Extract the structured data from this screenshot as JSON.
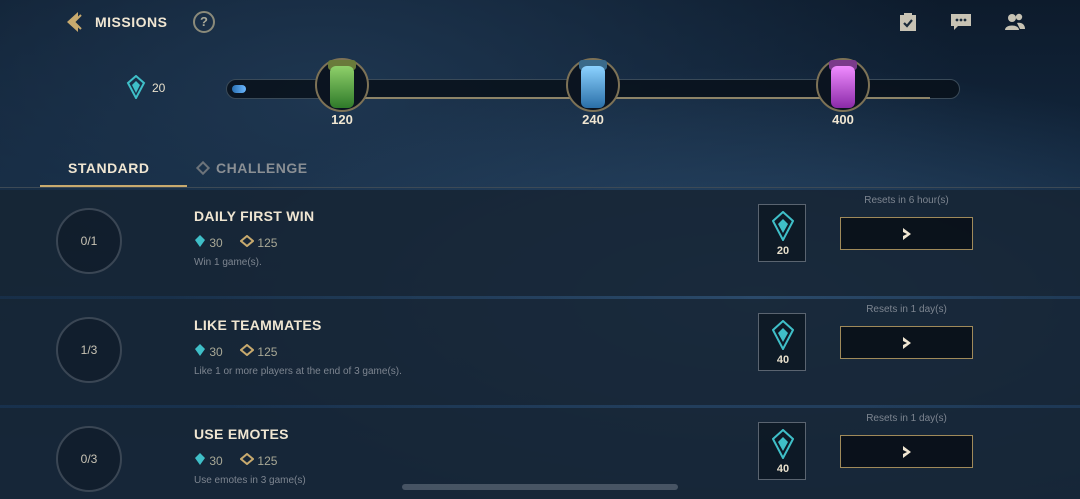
{
  "header": {
    "title": "MISSIONS",
    "help_label": "?",
    "icons": [
      "back-chevron-icon",
      "clipboard-check-icon",
      "chat-icon",
      "friends-icon"
    ]
  },
  "progress": {
    "current_xp": "20",
    "fill_fraction": 0.02,
    "rewards": [
      {
        "label": "120",
        "color": "#5fb04a"
      },
      {
        "label": "240",
        "color": "#4aa6d8"
      },
      {
        "label": "400",
        "color": "#c25ad8"
      }
    ]
  },
  "tabs": {
    "standard": "STANDARD",
    "challenge": "CHALLENGE"
  },
  "missions": [
    {
      "progress": "0/1",
      "title": "DAILY FIRST WIN",
      "xp": "30",
      "currency": "125",
      "description": "Win 1 game(s).",
      "token": "20",
      "reset": "Resets in 6 hour(s)"
    },
    {
      "progress": "1/3",
      "title": "LIKE TEAMMATES",
      "xp": "30",
      "currency": "125",
      "description": "Like 1 or more players at the end of 3 game(s).",
      "token": "40",
      "reset": "Resets in 1 day(s)"
    },
    {
      "progress": "0/3",
      "title": "USE EMOTES",
      "xp": "30",
      "currency": "125",
      "description": "Use emotes in 3 game(s)",
      "token": "40",
      "reset": "Resets in 1 day(s)"
    }
  ],
  "colors": {
    "gold": "#c8aa6e",
    "accent": "#3fbfc8"
  }
}
